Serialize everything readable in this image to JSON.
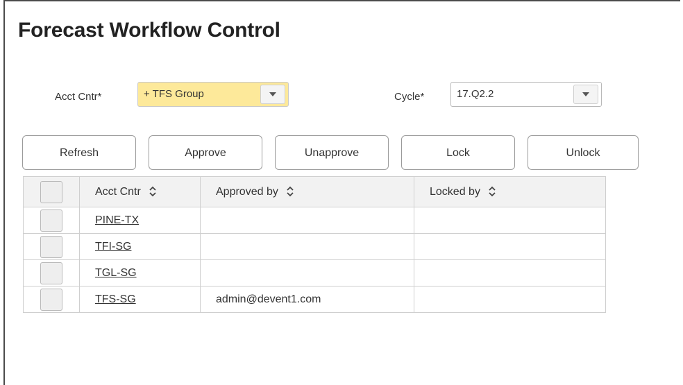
{
  "page": {
    "title": "Forecast Workflow Control"
  },
  "filters": {
    "acct_cntr_label": "Acct Cntr*",
    "acct_cntr_value": "+ TFS Group",
    "cycle_label": "Cycle*",
    "cycle_value": "17.Q2.2",
    "highlight_color": "#fde99a"
  },
  "actions": {
    "refresh": "Refresh",
    "approve": "Approve",
    "unapprove": "Unapprove",
    "lock": "Lock",
    "unlock": "Unlock"
  },
  "table": {
    "headers": {
      "acct_cntr": "Acct Cntr",
      "approved_by": "Approved by",
      "locked_by": "Locked by"
    },
    "sort_icon": "sort-updown-icon",
    "rows": [
      {
        "acct_cntr": "PINE-TX",
        "approved_by": "",
        "locked_by": ""
      },
      {
        "acct_cntr": "TFI-SG",
        "approved_by": "",
        "locked_by": ""
      },
      {
        "acct_cntr": "TGL-SG",
        "approved_by": "",
        "locked_by": ""
      },
      {
        "acct_cntr": "TFS-SG",
        "approved_by": "admin@devent1.com",
        "locked_by": ""
      }
    ]
  }
}
